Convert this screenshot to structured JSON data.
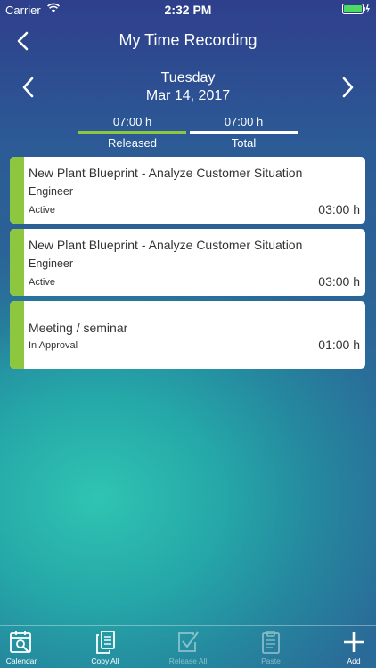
{
  "status_bar": {
    "carrier": "Carrier",
    "time": "2:32 PM"
  },
  "nav": {
    "title": "My Time Recording"
  },
  "date_header": {
    "weekday": "Tuesday",
    "date": "Mar 14, 2017"
  },
  "summary": {
    "released": {
      "hours": "07:00 h",
      "label": "Released"
    },
    "total": {
      "hours": "07:00 h",
      "label": "Total"
    }
  },
  "entries": [
    {
      "title": "New Plant Blueprint - Analyze Customer Situation",
      "role": "Engineer",
      "status": "Active",
      "duration": "03:00 h"
    },
    {
      "title": "New Plant Blueprint - Analyze Customer Situation",
      "role": "Engineer",
      "status": "Active",
      "duration": "03:00 h"
    },
    {
      "title": "Meeting / seminar",
      "role": "",
      "status": "In Approval",
      "duration": "01:00 h"
    }
  ],
  "toolbar": {
    "calendar": "Calendar",
    "copy_all": "Copy All",
    "release_all": "Release All",
    "paste": "Paste",
    "add": "Add"
  },
  "colors": {
    "accent_green": "#8dc63f",
    "card_bg": "#ffffff"
  },
  "icons": {
    "back": "chevron-left-icon",
    "prev": "chevron-left-icon",
    "next": "chevron-right-icon",
    "calendar": "calendar-search-icon",
    "copy": "copy-icon",
    "release": "check-box-icon",
    "paste": "clipboard-icon",
    "add": "plus-icon"
  }
}
